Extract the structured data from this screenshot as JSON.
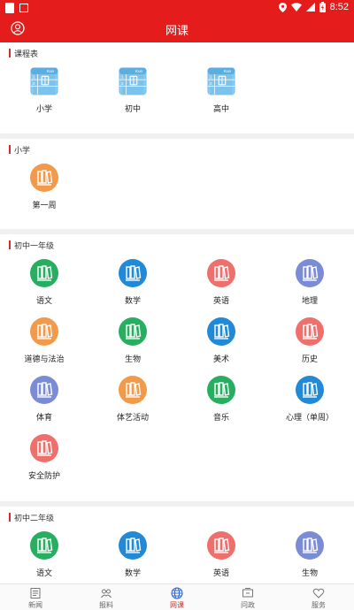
{
  "status": {
    "time": "8:52"
  },
  "header": {
    "title": "网课"
  },
  "schedule": {
    "label": "课程表",
    "items": [
      {
        "label": "小学"
      },
      {
        "label": "初中"
      },
      {
        "label": "高中"
      }
    ]
  },
  "primary": {
    "label": "小学",
    "items": [
      {
        "label": "第一周",
        "color": "#f2994a"
      }
    ]
  },
  "grade7": {
    "label": "初中一年级",
    "items": [
      {
        "label": "语文",
        "color": "#27ae60"
      },
      {
        "label": "数学",
        "color": "#2189d6"
      },
      {
        "label": "英语",
        "color": "#ef6f6c"
      },
      {
        "label": "地理",
        "color": "#7b8cd6"
      },
      {
        "label": "道德与法治",
        "color": "#f2994a"
      },
      {
        "label": "生物",
        "color": "#27ae60"
      },
      {
        "label": "美术",
        "color": "#2189d6"
      },
      {
        "label": "历史",
        "color": "#ef6f6c"
      },
      {
        "label": "体育",
        "color": "#7b8cd6"
      },
      {
        "label": "体艺活动",
        "color": "#f2994a"
      },
      {
        "label": "音乐",
        "color": "#27ae60"
      },
      {
        "label": "心理（单周）",
        "color": "#2189d6"
      },
      {
        "label": "安全防护",
        "color": "#ef6f6c"
      }
    ]
  },
  "grade8": {
    "label": "初中二年级",
    "items": [
      {
        "label": "语文",
        "color": "#27ae60"
      },
      {
        "label": "数学",
        "color": "#2189d6"
      },
      {
        "label": "英语",
        "color": "#ef6f6c"
      },
      {
        "label": "生物",
        "color": "#7b8cd6"
      }
    ]
  },
  "tabs": [
    {
      "label": "新闻",
      "icon": "news-icon"
    },
    {
      "label": "报料",
      "icon": "report-icon"
    },
    {
      "label": "网课",
      "icon": "globe-icon"
    },
    {
      "label": "问政",
      "icon": "inquiry-icon"
    },
    {
      "label": "服务",
      "icon": "heart-icon"
    }
  ]
}
